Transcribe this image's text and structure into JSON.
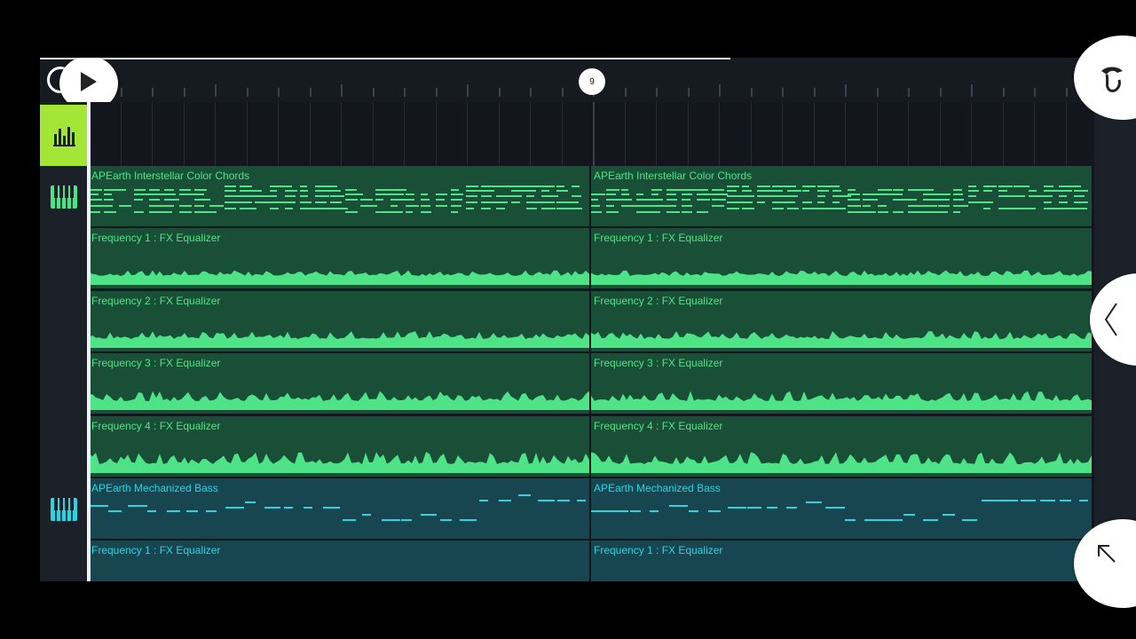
{
  "progress_fraction": 0.63,
  "ruler": {
    "bar_marker": "9"
  },
  "tracks": [
    {
      "color": "green",
      "kind": "notes",
      "clips": [
        "APEarth Interstellar Color Chords",
        "APEarth Interstellar Color Chords"
      ]
    },
    {
      "color": "green",
      "kind": "wave",
      "clips": [
        "Frequency 1 : FX Equalizer",
        "Frequency 1 : FX Equalizer"
      ]
    },
    {
      "color": "green",
      "kind": "wave",
      "clips": [
        "Frequency 2 : FX Equalizer",
        "Frequency 2 : FX Equalizer"
      ]
    },
    {
      "color": "green",
      "kind": "wave",
      "clips": [
        "Frequency 3 : FX Equalizer",
        "Frequency 3 : FX Equalizer"
      ]
    },
    {
      "color": "green",
      "kind": "wave",
      "clips": [
        "Frequency 4 : FX Equalizer",
        "Frequency 4 : FX Equalizer"
      ]
    },
    {
      "color": "teal",
      "kind": "bass",
      "clips": [
        "APEarth Mechanized Bass",
        "APEarth Mechanized Bass"
      ]
    },
    {
      "color": "teal",
      "kind": "none",
      "clips": [
        "Frequency 1 : FX Equalizer",
        "Frequency 1 : FX Equalizer"
      ]
    }
  ],
  "colors": {
    "accent": "#a3e635",
    "green_note": "#4ee386",
    "teal_note": "#2fd2de"
  },
  "icons": {
    "play": "play-icon",
    "loop": "loop-icon",
    "mixer": "mixer-icon",
    "piano_roll": "piano-icon",
    "logo": "fruit-logo-icon",
    "collapse": "chevron-left-icon",
    "expand": "expand-arrow-icon"
  }
}
